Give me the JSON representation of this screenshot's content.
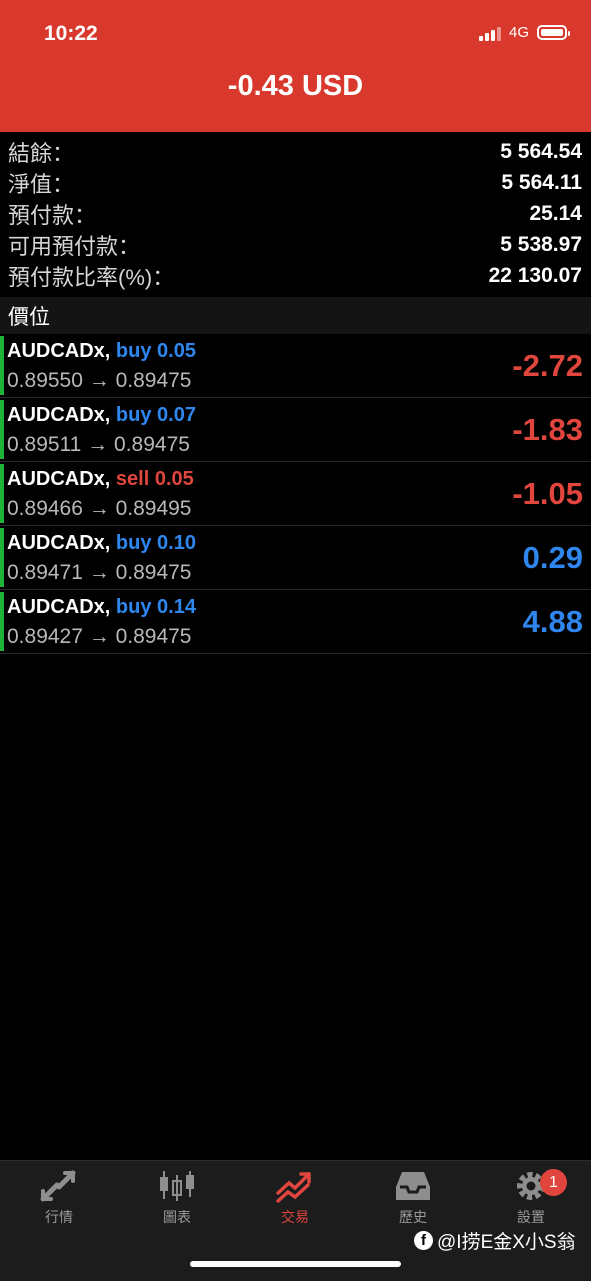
{
  "status_bar": {
    "time": "10:22",
    "network": "4G"
  },
  "header": {
    "title": "-0.43 USD",
    "bg_color": "#d9392c"
  },
  "summary": [
    {
      "label": "結餘：",
      "value": "5 564.54"
    },
    {
      "label": "淨值：",
      "value": "5 564.11"
    },
    {
      "label": "預付款：",
      "value": "25.14"
    },
    {
      "label": "可用預付款：",
      "value": "5 538.97"
    },
    {
      "label": "預付款比率(%)：",
      "value": "22 130.07"
    }
  ],
  "positions_section": {
    "title": "價位"
  },
  "positions": [
    {
      "symbol": "AUDCADx,",
      "side": "buy",
      "volume": "0.05",
      "prices": "0.89550 → 0.89475",
      "pl": "-2.72",
      "pl_sign": "neg"
    },
    {
      "symbol": "AUDCADx,",
      "side": "buy",
      "volume": "0.07",
      "prices": "0.89511 → 0.89475",
      "pl": "-1.83",
      "pl_sign": "neg"
    },
    {
      "symbol": "AUDCADx,",
      "side": "sell",
      "volume": "0.05",
      "prices": "0.89466 → 0.89495",
      "pl": "-1.05",
      "pl_sign": "neg"
    },
    {
      "symbol": "AUDCADx,",
      "side": "buy",
      "volume": "0.10",
      "prices": "0.89471 → 0.89475",
      "pl": "0.29",
      "pl_sign": "pos"
    },
    {
      "symbol": "AUDCADx,",
      "side": "buy",
      "volume": "0.14",
      "prices": "0.89427 → 0.89475",
      "pl": "4.88",
      "pl_sign": "pos"
    }
  ],
  "colors": {
    "buy": "#2f86ee",
    "sell": "#e0463d",
    "loss": "#e0463d",
    "profit": "#2f86ee",
    "active_tab": "#e0463d",
    "position_marker": "#1fb33a"
  },
  "tabs": [
    {
      "label": "行情",
      "icon": "quotes-arrows-icon",
      "active": false
    },
    {
      "label": "圖表",
      "icon": "candlestick-chart-icon",
      "active": false
    },
    {
      "label": "交易",
      "icon": "trade-trend-icon",
      "active": true
    },
    {
      "label": "歷史",
      "icon": "history-inbox-icon",
      "active": false
    },
    {
      "label": "設置",
      "icon": "settings-gear-icon",
      "active": false,
      "badge": "1"
    }
  ],
  "watermark": {
    "text": "@I捞E金X小S翁"
  }
}
